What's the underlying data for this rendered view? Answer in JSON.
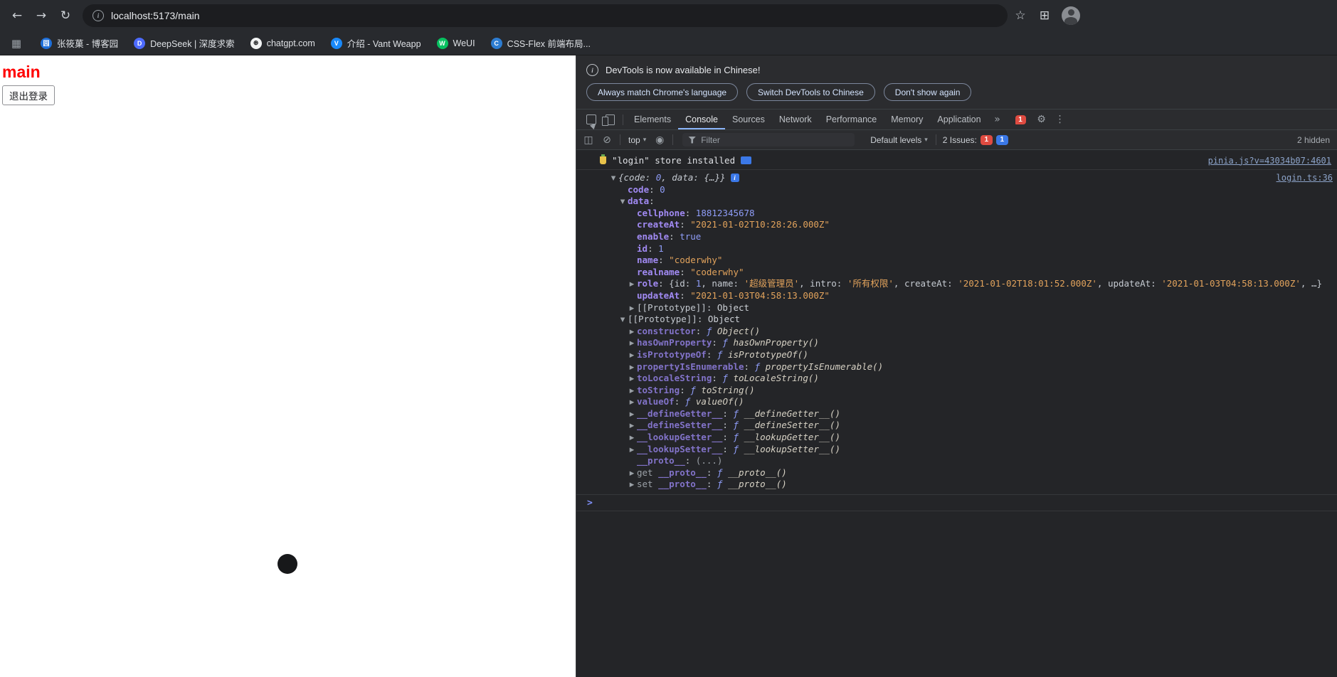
{
  "icons": {
    "back": "←",
    "forward": "→",
    "reload": "↻",
    "star": "☆",
    "extensions": "⊞",
    "apps_grid": "▦",
    "more_tabs": "»",
    "gear": "⚙",
    "kebab": "⋮",
    "sidebar": "◫",
    "clear": "⊘",
    "eye": "◉",
    "dropdown": "▾",
    "prompt": ">",
    "info_letter": "i"
  },
  "browser": {
    "url": "localhost:5173/main",
    "bookmarks": [
      {
        "label": "张筱菓 - 博客园",
        "fav_color": "#1e6fd9",
        "fav_glyph": "园"
      },
      {
        "label": "DeepSeek | 深度求索",
        "fav_color": "#4d6bfe",
        "fav_glyph": "D"
      },
      {
        "label": "chatgpt.com",
        "fav_color": "#f1f3f4",
        "fav_glyph": "⊛",
        "fav_text": "#202124"
      },
      {
        "label": "介绍 - Vant Weapp",
        "fav_color": "#1989fa",
        "fav_glyph": "V"
      },
      {
        "label": "WeUI",
        "fav_color": "#07c160",
        "fav_glyph": "W"
      },
      {
        "label": "CSS-Flex 前端布局...",
        "fav_color": "#2d7dd2",
        "fav_glyph": "C"
      }
    ]
  },
  "page": {
    "heading": "main",
    "logout": "退出登录"
  },
  "devtools": {
    "infobar": {
      "message": "DevTools is now available in Chinese!",
      "buttons": [
        "Always match Chrome's language",
        "Switch DevTools to Chinese",
        "Don't show again"
      ]
    },
    "tabs": [
      "Elements",
      "Console",
      "Sources",
      "Network",
      "Performance",
      "Memory",
      "Application"
    ],
    "active_tab": "Console",
    "tabbar_error_count": "1",
    "toolbar": {
      "context": "top",
      "filter_placeholder": "Filter",
      "levels": "Default levels",
      "issues": "2 Issues:",
      "err": "1",
      "warn": "1",
      "hidden": "2 hidden"
    },
    "console": {
      "msg1": {
        "text": "\"login\" store installed",
        "source": "pinia.js?v=43034b07:4601"
      },
      "msg2_source": "login.ts:36",
      "preview_segs": [
        {
          "c": "plain",
          "t": "{code: "
        },
        {
          "c": "num",
          "t": "0"
        },
        {
          "c": "plain",
          "t": ", data: {…}}"
        }
      ],
      "rows": [
        {
          "lvl": 1,
          "arrow": "",
          "pre": "",
          "ks": "own",
          "key": "code",
          "vt": "num",
          "val": "0"
        },
        {
          "lvl": 1,
          "arrow": "v",
          "pre": "",
          "ks": "own",
          "key": "data",
          "vt": "none",
          "val": ""
        },
        {
          "lvl": 2,
          "arrow": "",
          "pre": "",
          "ks": "own",
          "key": "cellphone",
          "vt": "num",
          "val": "18812345678"
        },
        {
          "lvl": 2,
          "arrow": "",
          "pre": "",
          "ks": "own",
          "key": "createAt",
          "vt": "str",
          "val": "\"2021-01-02T10:28:26.000Z\""
        },
        {
          "lvl": 2,
          "arrow": "",
          "pre": "",
          "ks": "own",
          "key": "enable",
          "vt": "num",
          "val": "true"
        },
        {
          "lvl": 2,
          "arrow": "",
          "pre": "",
          "ks": "own",
          "key": "id",
          "vt": "num",
          "val": "1"
        },
        {
          "lvl": 2,
          "arrow": "",
          "pre": "",
          "ks": "own",
          "key": "name",
          "vt": "str",
          "val": "\"coderwhy\""
        },
        {
          "lvl": 2,
          "arrow": "",
          "pre": "",
          "ks": "own",
          "key": "realname",
          "vt": "str",
          "val": "\"coderwhy\""
        },
        {
          "lvl": 2,
          "arrow": ">",
          "pre": "",
          "ks": "own",
          "key": "role",
          "vt": "segs",
          "segs": [
            {
              "c": "plain",
              "t": "{id: "
            },
            {
              "c": "num",
              "t": "1"
            },
            {
              "c": "plain",
              "t": ", name: "
            },
            {
              "c": "str",
              "t": "'超级管理员'"
            },
            {
              "c": "plain",
              "t": ", intro: "
            },
            {
              "c": "str",
              "t": "'所有权限'"
            },
            {
              "c": "plain",
              "t": ", createAt: "
            },
            {
              "c": "str",
              "t": "'2021-01-02T18:01:52.000Z'"
            },
            {
              "c": "plain",
              "t": ", updateAt: "
            },
            {
              "c": "str",
              "t": "'2021-01-03T04:58:13.000Z'"
            },
            {
              "c": "plain",
              "t": ", …}"
            }
          ]
        },
        {
          "lvl": 2,
          "arrow": "",
          "pre": "",
          "ks": "own",
          "key": "updateAt",
          "vt": "str",
          "val": "\"2021-01-03T04:58:13.000Z\""
        },
        {
          "lvl": 2,
          "arrow": ">",
          "pre": "",
          "ks": "internal",
          "key": "[[Prototype]]",
          "vt": "obj",
          "val": "Object"
        },
        {
          "lvl": 1,
          "arrow": "v",
          "pre": "",
          "ks": "internal",
          "key": "[[Prototype]]",
          "vt": "obj",
          "val": "Object"
        },
        {
          "lvl": 2,
          "arrow": ">",
          "pre": "",
          "ks": "dim",
          "key": "constructor",
          "vt": "fn",
          "val": "ƒ Object()"
        },
        {
          "lvl": 2,
          "arrow": ">",
          "pre": "",
          "ks": "dim",
          "key": "hasOwnProperty",
          "vt": "fn",
          "val": "ƒ hasOwnProperty()"
        },
        {
          "lvl": 2,
          "arrow": ">",
          "pre": "",
          "ks": "dim",
          "key": "isPrototypeOf",
          "vt": "fn",
          "val": "ƒ isPrototypeOf()"
        },
        {
          "lvl": 2,
          "arrow": ">",
          "pre": "",
          "ks": "dim",
          "key": "propertyIsEnumerable",
          "vt": "fn",
          "val": "ƒ propertyIsEnumerable()"
        },
        {
          "lvl": 2,
          "arrow": ">",
          "pre": "",
          "ks": "dim",
          "key": "toLocaleString",
          "vt": "fn",
          "val": "ƒ toLocaleString()"
        },
        {
          "lvl": 2,
          "arrow": ">",
          "pre": "",
          "ks": "dim",
          "key": "toString",
          "vt": "fn",
          "val": "ƒ toString()"
        },
        {
          "lvl": 2,
          "arrow": ">",
          "pre": "",
          "ks": "dim",
          "key": "valueOf",
          "vt": "fn",
          "val": "ƒ valueOf()"
        },
        {
          "lvl": 2,
          "arrow": ">",
          "pre": "",
          "ks": "dim",
          "key": "__defineGetter__",
          "vt": "fn",
          "val": "ƒ __defineGetter__()"
        },
        {
          "lvl": 2,
          "arrow": ">",
          "pre": "",
          "ks": "dim",
          "key": "__defineSetter__",
          "vt": "fn",
          "val": "ƒ __defineSetter__()"
        },
        {
          "lvl": 2,
          "arrow": ">",
          "pre": "",
          "ks": "dim",
          "key": "__lookupGetter__",
          "vt": "fn",
          "val": "ƒ __lookupGetter__()"
        },
        {
          "lvl": 2,
          "arrow": ">",
          "pre": "",
          "ks": "dim",
          "key": "__lookupSetter__",
          "vt": "fn",
          "val": "ƒ __lookupSetter__()"
        },
        {
          "lvl": 2,
          "arrow": "",
          "pre": "",
          "ks": "dim",
          "key": "__proto__",
          "vt": "acc",
          "val": "(...)"
        },
        {
          "lvl": 2,
          "arrow": ">",
          "pre": "get ",
          "ks": "dim",
          "key": "__proto__",
          "vt": "fn",
          "val": "ƒ __proto__()"
        },
        {
          "lvl": 2,
          "arrow": ">",
          "pre": "set ",
          "ks": "dim",
          "key": "__proto__",
          "vt": "fn",
          "val": "ƒ __proto__()"
        }
      ]
    }
  }
}
